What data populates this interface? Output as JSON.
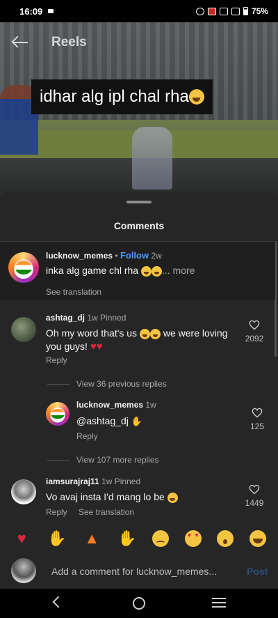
{
  "status_bar": {
    "time": "16:09",
    "battery": "75%"
  },
  "header": {
    "title": "Reels"
  },
  "video": {
    "caption_text": "idhar alg ipl chal rha"
  },
  "sheet": {
    "title": "Comments"
  },
  "caption_comment": {
    "username": "lucknow_memes",
    "separator": "•",
    "follow_label": "Follow",
    "age": "2w",
    "text": "inka alg game chl rha",
    "more_label": "... more",
    "see_translation": "See translation"
  },
  "comments": [
    {
      "username": "ashtag_dj",
      "age": "1w",
      "pinned": "Pinned",
      "text": "Oh my word that's us",
      "text2": "we were loving you guys!",
      "reply_label": "Reply",
      "likes": "2092",
      "view_replies": "View 36 previous replies"
    },
    {
      "username": "lucknow_memes",
      "age": "1w",
      "text": "@ashtag_dj",
      "reply_label": "Reply",
      "likes": "125",
      "view_replies": "View 107 more replies"
    },
    {
      "username": "iamsurajraj11",
      "age": "1w",
      "pinned": "Pinned",
      "text": "Vo avaj insta I'd mang lo be",
      "reply_label": "Reply",
      "see_translation": "See translation",
      "likes": "1449"
    }
  ],
  "reactions": [
    "heart",
    "raised-hands",
    "fire",
    "clapping-hands",
    "crying-face",
    "heart-eyes-face",
    "surprised-face",
    "laughing-face"
  ],
  "compose": {
    "placeholder": "Add a comment for lucknow_memes...",
    "post_label": "Post"
  },
  "colors": {
    "accent": "#4a9cf6",
    "sheet_bg": "#262626",
    "like_red": "#e0263b"
  }
}
